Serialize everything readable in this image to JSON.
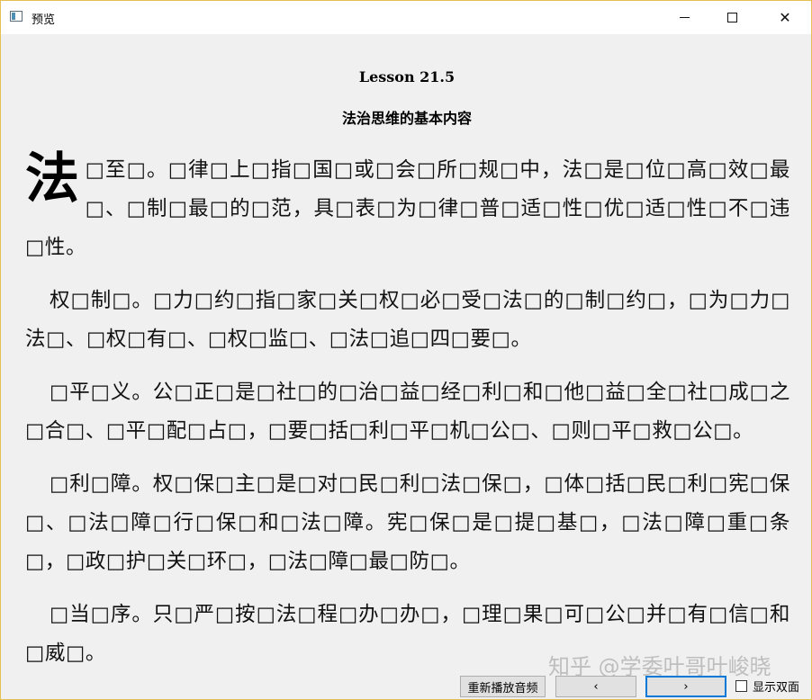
{
  "window": {
    "title": "预览",
    "controls": {
      "minimize_icon": "minimize-icon",
      "maximize_icon": "maximize-icon",
      "close_icon": "close-icon",
      "close_glyph": "✕"
    }
  },
  "lesson": {
    "title": "Lesson 21.5",
    "subtitle": "法治思维的基本内容",
    "drop_cap": "法",
    "paragraphs": [
      "□至□。□律□上□指□国□或□会□所□规□中，法□是□位□高□效□最□、□制□最□的□范，具□表□为□律□普□适□性□优□适□性□不□违□性。",
      "权□制□。□力□约□指□家□关□权□必□受□法□的□制□约□，□为□力□法□、□权□有□、□权□监□、□法□追□四□要□。",
      "□平□义。公□正□是□社□的□治□益□经□利□和□他□益□全□社□成□之□合□、□平□配□占□，□要□括□利□平□机□公□、□则□平□救□公□。",
      "□利□障。权□保□主□是□对□民□利□法□保□，□体□括□民□利□宪□保□、□法□障□行□保□和□法□障。宪□保□是□提□基□，□法□障□重□条□，□政□护□关□环□，□法□障□最□防□。",
      "□当□序。只□严□按□法□程□办□办□，□理□果□可□公□并□有□信□和□威□。"
    ]
  },
  "watermark": "知乎 @学委叶哥叶峻晓",
  "toolbar": {
    "replay_label": "重新播放音频",
    "prev_label": "‹",
    "next_label": "›",
    "double_page_label": "显示双面",
    "double_page_checked": false
  }
}
